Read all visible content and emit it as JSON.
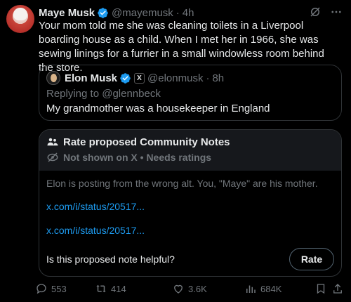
{
  "tweet": {
    "author_name": "Maye Musk",
    "handle": "@mayemusk",
    "separator": "·",
    "time": "4h",
    "text": "Your mom told me she was cleaning toilets in a Liverpool boarding house as a child. When I met her in 1966, she was sewing linings for a furrier in a small windowless room behind the store."
  },
  "quote": {
    "author_name": "Elon Musk",
    "x_badge": "X",
    "handle": "@elonmusk",
    "separator": "·",
    "time": "8h",
    "replying_to": "Replying to @glennbeck",
    "text": "My grandmother was a housekeeper in England"
  },
  "community_notes": {
    "title": "Rate proposed Community Notes",
    "subtitle": "Not shown on X • Needs ratings",
    "note_text": "Elon is posting from the wrong alt. You, \"Maye\" are his mother.",
    "link1": "x.com/i/status/20517...",
    "link2": "x.com/i/status/20517...",
    "question": "Is this proposed note helpful?",
    "rate_label": "Rate"
  },
  "actions": {
    "replies": "553",
    "reposts": "414",
    "likes": "3.6K",
    "views": "684K"
  },
  "colors": {
    "background": "#000000",
    "text": "#e7e9ea",
    "muted": "#71767b",
    "link": "#1d9bf0",
    "border": "#2f3336",
    "verified": "#1d9bf0"
  }
}
